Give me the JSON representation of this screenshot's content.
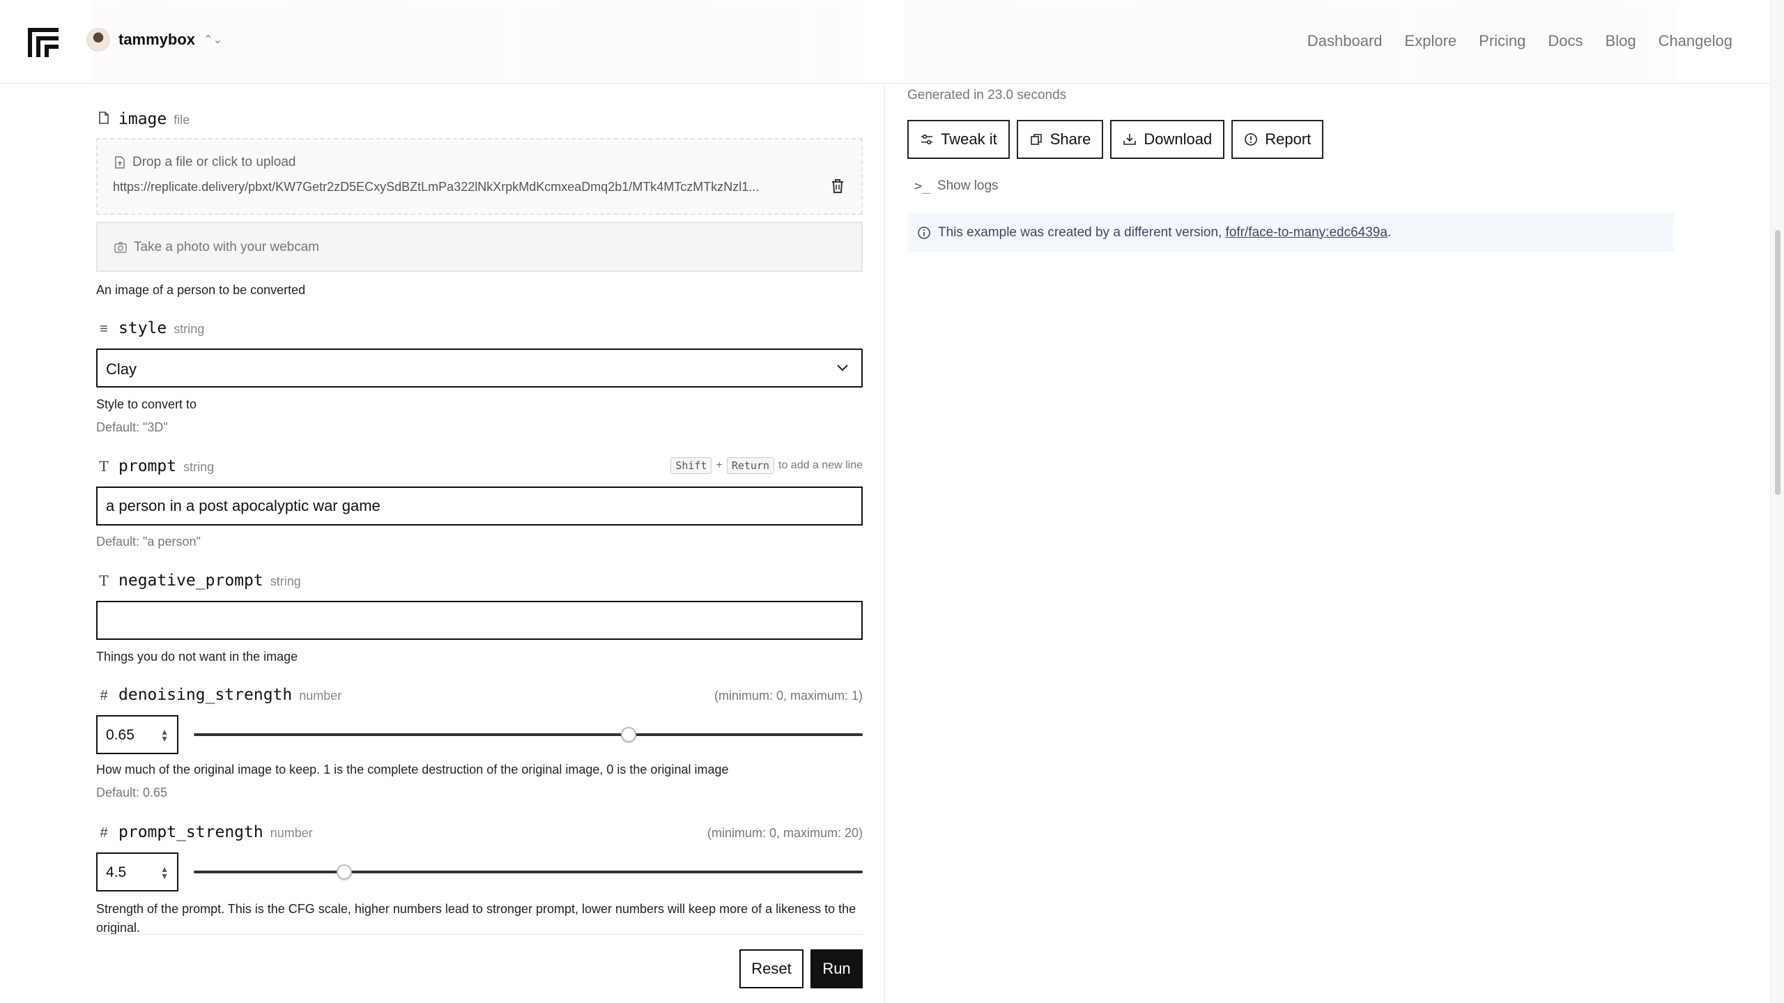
{
  "header": {
    "account_name": "tammybox",
    "nav": [
      "Dashboard",
      "Explore",
      "Pricing",
      "Docs",
      "Blog",
      "Changelog"
    ]
  },
  "fields": {
    "image": {
      "name": "image",
      "type": "file",
      "dropzone_label": "Drop a file or click to upload",
      "url": "https://replicate.delivery/pbxt/KW7Getr2zD5ECxySdBZtLmPa322lNkXrpkMdKcmxeaDmq2b1/MTk4MTczMTkzNzl1...",
      "webcam_label": "Take a photo with your webcam",
      "help": "An image of a person to be converted"
    },
    "style": {
      "name": "style",
      "type": "string",
      "value": "Clay",
      "help": "Style to convert to",
      "default": "Default: \"3D\""
    },
    "prompt": {
      "name": "prompt",
      "type": "string",
      "value": "a person in a post apocalyptic war game",
      "default": "Default: \"a person\"",
      "hint_key1": "Shift",
      "hint_plus": "+",
      "hint_key2": "Return",
      "hint_text": "to add a new line"
    },
    "negative_prompt": {
      "name": "negative_prompt",
      "type": "string",
      "value": "",
      "help": "Things you do not want in the image"
    },
    "denoising_strength": {
      "name": "denoising_strength",
      "type": "number",
      "value": "0.65",
      "min": 0,
      "max": 1,
      "range_text": "(minimum: 0, maximum: 1)",
      "help": "How much of the original image to keep. 1 is the complete destruction of the original image, 0 is the original image",
      "default": "Default: 0.65"
    },
    "prompt_strength": {
      "name": "prompt_strength",
      "type": "number",
      "value": "4.5",
      "min": 0,
      "max": 20,
      "range_text": "(minimum: 0, maximum: 20)",
      "help": "Strength of the prompt. This is the CFG scale, higher numbers lead to stronger prompt, lower numbers will keep more of a likeness to the original."
    }
  },
  "form_actions": {
    "reset": "Reset",
    "run": "Run"
  },
  "output": {
    "generated_time": "Generated in 23.0 seconds",
    "buttons": {
      "tweak": "Tweak it",
      "share": "Share",
      "download": "Download",
      "report": "Report"
    },
    "show_logs": "Show logs",
    "notice_text": "This example was created by a different version,",
    "notice_link": "fofr/face-to-many:edc6439a",
    "notice_period": "."
  },
  "colors": {
    "notice_bg": "#f4f7fb",
    "notice_text": "#3d4a5c",
    "run_bg": "#111111"
  }
}
